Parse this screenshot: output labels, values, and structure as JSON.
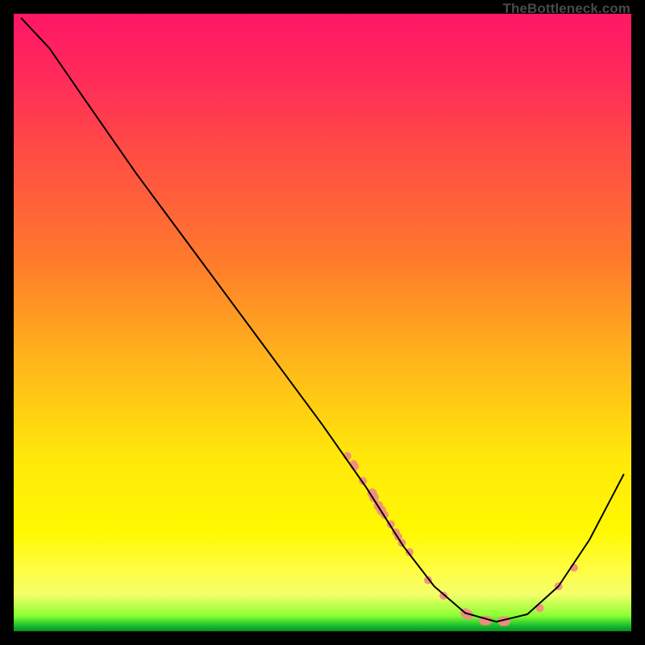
{
  "watermark": "TheBottleneck.com",
  "chart_data": {
    "type": "line",
    "title": "",
    "xlabel": "",
    "ylabel": "",
    "xlim": [
      0,
      100
    ],
    "ylim": [
      0,
      100
    ],
    "grid": false,
    "curve": {
      "name": "curve",
      "color": "#000000",
      "stroke_width": 2,
      "points": [
        {
          "x": 1.5,
          "y": 99.0
        },
        {
          "x": 6.0,
          "y": 94.2
        },
        {
          "x": 12.0,
          "y": 85.5
        },
        {
          "x": 20.0,
          "y": 74.0
        },
        {
          "x": 30.0,
          "y": 60.5
        },
        {
          "x": 40.0,
          "y": 47.0
        },
        {
          "x": 50.0,
          "y": 33.5
        },
        {
          "x": 57.0,
          "y": 23.5
        },
        {
          "x": 63.0,
          "y": 14.0
        },
        {
          "x": 68.0,
          "y": 7.5
        },
        {
          "x": 73.0,
          "y": 3.2
        },
        {
          "x": 78.0,
          "y": 1.8
        },
        {
          "x": 83.0,
          "y": 3.0
        },
        {
          "x": 88.0,
          "y": 7.5
        },
        {
          "x": 93.0,
          "y": 15.0
        },
        {
          "x": 98.5,
          "y": 25.5
        }
      ]
    },
    "markers": {
      "name": "highlighted-points",
      "color": "#f28b82",
      "points": [
        {
          "x": 54.0,
          "y": 28.5,
          "r": 5
        },
        {
          "x": 55.0,
          "y": 27.2,
          "r": 5
        },
        {
          "x": 55.2,
          "y": 26.8,
          "r": 5
        },
        {
          "x": 56.5,
          "y": 24.5,
          "r": 5
        },
        {
          "x": 58.0,
          "y": 22.5,
          "r": 6
        },
        {
          "x": 58.3,
          "y": 21.8,
          "r": 6
        },
        {
          "x": 59.0,
          "y": 20.5,
          "r": 6
        },
        {
          "x": 59.5,
          "y": 19.7,
          "r": 6
        },
        {
          "x": 60.0,
          "y": 19.0,
          "r": 5
        },
        {
          "x": 61.0,
          "y": 17.5,
          "r": 5
        },
        {
          "x": 61.8,
          "y": 16.2,
          "r": 5
        },
        {
          "x": 62.2,
          "y": 15.5,
          "r": 5
        },
        {
          "x": 62.8,
          "y": 14.5,
          "r": 5
        },
        {
          "x": 64.0,
          "y": 13.0,
          "r": 5
        },
        {
          "x": 67.0,
          "y": 8.5,
          "r": 5
        },
        {
          "x": 69.5,
          "y": 6.0,
          "r": 5
        },
        {
          "x": 73.0,
          "y": 3.2,
          "r": 6
        },
        {
          "x": 73.5,
          "y": 2.9,
          "r": 6
        },
        {
          "x": 76.0,
          "y": 2.0,
          "r": 6
        },
        {
          "x": 76.5,
          "y": 2.0,
          "r": 6
        },
        {
          "x": 79.0,
          "y": 1.9,
          "r": 6
        },
        {
          "x": 79.5,
          "y": 1.9,
          "r": 6
        },
        {
          "x": 85.0,
          "y": 4.0,
          "r": 5
        },
        {
          "x": 88.0,
          "y": 7.5,
          "r": 5
        },
        {
          "x": 90.5,
          "y": 10.5,
          "r": 5
        }
      ]
    }
  }
}
